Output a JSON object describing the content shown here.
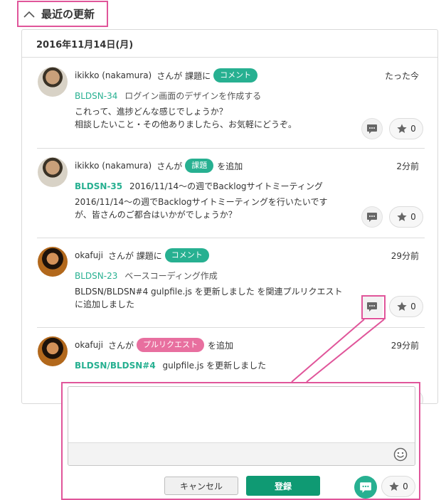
{
  "section": {
    "title": "最近の更新"
  },
  "date_header": "2016年11月14日(月)",
  "items": [
    {
      "user": "ikikko (nakamura)",
      "action_pre": "さんが 課題に",
      "badge": "コメント",
      "action_post": "",
      "time": "たった今",
      "issue_key": "BLDSN-34",
      "issue_title": "ログイン画面のデザインを作成する",
      "desc_line1": "これって、進捗どんな感じでしょうか？",
      "desc_line2": "相談したいこと・その他ありましたら、お気軽にどうぞ。",
      "star_count": "0"
    },
    {
      "user": "ikikko (nakamura)",
      "action_pre": "さんが",
      "badge": "課題",
      "action_post": "を追加",
      "time": "2分前",
      "issue_key": "BLDSN-35",
      "issue_title": "2016/11/14〜の週でBacklogサイトミーティング",
      "desc_line1": "2016/11/14〜の週でBacklogサイトミーティングを行いたいです",
      "desc_line2": "が、皆さんのご都合はいかがでしょうか？",
      "star_count": "0"
    },
    {
      "user": "okafuji",
      "action_pre": "さんが 課題に",
      "badge": "コメント",
      "action_post": "",
      "time": "29分前",
      "issue_key": "BLDSN-23",
      "issue_title": "ベースコーディング作成",
      "desc_line1": "BLDSN/BLDSN#4 gulpfile.js を更新しました を関連プルリクエスト",
      "desc_line2": "に追加しました",
      "star_count": "0"
    },
    {
      "user": "okafuji",
      "action_pre": "さんが",
      "badge": "プルリクエスト",
      "action_post": "を追加",
      "time": "29分前",
      "issue_key": "BLDSN/BLDSN#4",
      "issue_title": "gulpfile.js を更新しました"
    }
  ],
  "comment_form": {
    "placeholder": "",
    "cancel_label": "キャンセル",
    "submit_label": "登録",
    "star_count": "0"
  },
  "colors": {
    "accent_green": "#27b091",
    "accent_pink": "#e86f9f",
    "highlight": "#e0559a"
  }
}
